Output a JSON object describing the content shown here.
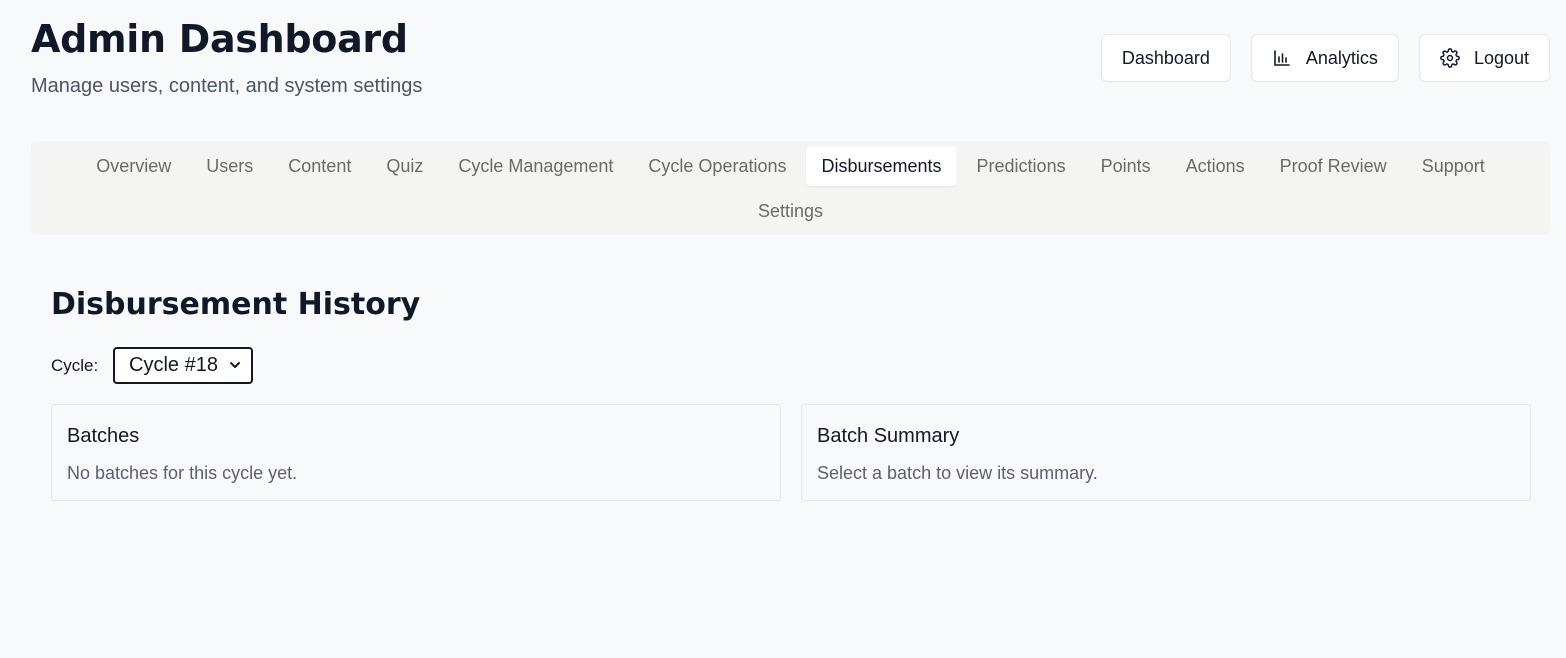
{
  "header": {
    "title": "Admin Dashboard",
    "subtitle": "Manage users, content, and system settings",
    "actions": {
      "dashboard": {
        "label": "Dashboard"
      },
      "analytics": {
        "label": "Analytics",
        "icon": "bar-chart-icon"
      },
      "logout": {
        "label": "Logout",
        "icon": "gear-icon"
      }
    }
  },
  "tabs": {
    "items": [
      {
        "label": "Overview"
      },
      {
        "label": "Users"
      },
      {
        "label": "Content"
      },
      {
        "label": "Quiz"
      },
      {
        "label": "Cycle Management"
      },
      {
        "label": "Cycle Operations"
      },
      {
        "label": "Disbursements",
        "active": true
      },
      {
        "label": "Predictions"
      },
      {
        "label": "Points"
      },
      {
        "label": "Actions"
      },
      {
        "label": "Proof Review"
      },
      {
        "label": "Support"
      },
      {
        "label": "Settings"
      }
    ]
  },
  "disbursements": {
    "title": "Disbursement History",
    "cycle_label": "Cycle:",
    "cycle_selected": "Cycle #18",
    "batches": {
      "title": "Batches",
      "empty_text": "No batches for this cycle yet."
    },
    "summary": {
      "title": "Batch Summary",
      "empty_text": "Select a batch to view its summary."
    }
  }
}
